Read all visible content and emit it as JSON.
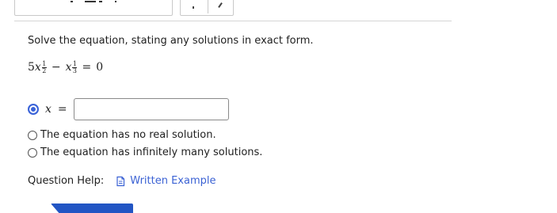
{
  "question": {
    "prompt": "Solve the equation, stating any solutions in exact form.",
    "equation": {
      "coef": "5",
      "var": "x",
      "exp1_num": "1",
      "exp1_den": "2",
      "minus": "−",
      "exp2_num": "1",
      "exp2_den": "3",
      "equals": "=",
      "rhs": "0"
    }
  },
  "options": [
    {
      "lhs": "x",
      "eq": "=",
      "value": "",
      "selected": true
    },
    {
      "label": "The equation has no real solution.",
      "selected": false
    },
    {
      "label": "The equation has infinitely many solutions.",
      "selected": false
    }
  ],
  "help": {
    "label": "Question Help:",
    "link_label": "Written Example"
  },
  "colors": {
    "accent": "#3a63d8",
    "link": "#3b62d4",
    "bottom_bar": "#2255c4"
  },
  "icons": {
    "help_link": "document-icon"
  }
}
